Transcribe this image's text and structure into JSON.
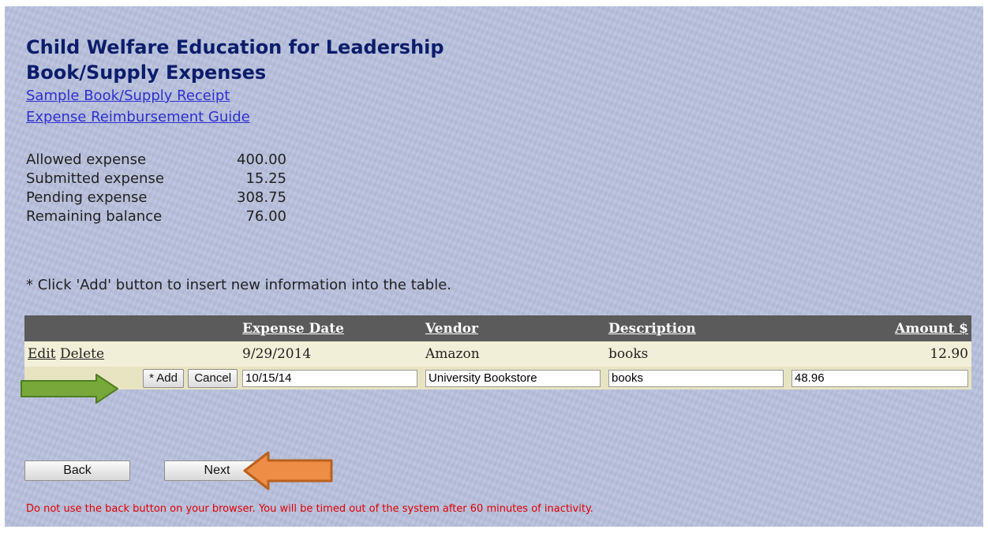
{
  "header": {
    "title_line1": "Child Welfare Education for Leadership",
    "title_line2": "Book/Supply Expenses"
  },
  "links": {
    "sample_receipt": "Sample Book/Supply Receipt",
    "reimbursement_guide": "Expense Reimbursement Guide"
  },
  "summary": [
    {
      "label": "Allowed expense",
      "value": "400.00"
    },
    {
      "label": "Submitted expense",
      "value": "15.25"
    },
    {
      "label": "Pending expense",
      "value": "308.75"
    },
    {
      "label": "Remaining balance",
      "value": "76.00"
    }
  ],
  "note": "* Click 'Add' button to insert new information into the table.",
  "table": {
    "headers": {
      "expense_date": "Expense Date",
      "vendor": "Vendor",
      "description": "Description",
      "amount": "Amount $"
    },
    "row": {
      "edit": "Edit",
      "delete": "Delete",
      "date": "9/29/2014",
      "vendor": "Amazon",
      "description": "books",
      "amount": "12.90"
    },
    "new_row": {
      "add_label": "* Add",
      "cancel_label": "Cancel",
      "date": "10/15/14",
      "vendor": "University Bookstore",
      "description": "books",
      "amount": "48.96"
    }
  },
  "nav": {
    "back_label": "Back",
    "next_label": "Next"
  },
  "warning": "Do not use the back button on your browser. You will be timed out of the system after 60 minutes of inactivity.",
  "colors": {
    "page_bg": "#b7c0dc",
    "title": "#0b1d6b",
    "link": "#2f2fcf",
    "header_bg": "#5b5b5b",
    "warning": "#e00000",
    "arrow_green": "#78a83a",
    "arrow_orange": "#ee8d45"
  },
  "annotations": {
    "add_arrow_icon": "green-right-arrow",
    "next_arrow_icon": "orange-left-arrow"
  }
}
